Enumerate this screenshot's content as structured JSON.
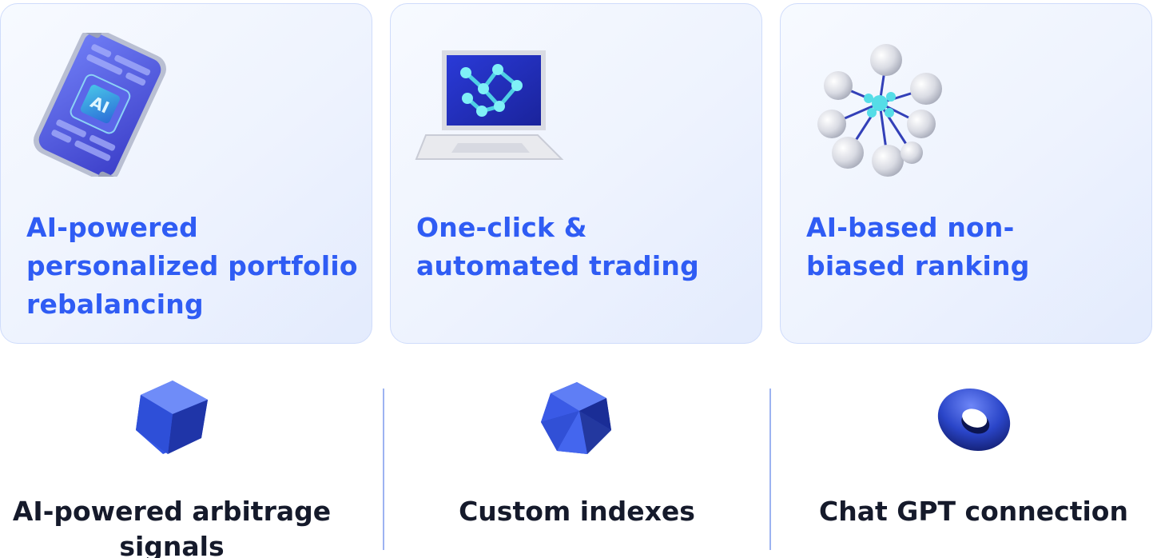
{
  "cards": [
    {
      "title": "AI-powered personalized portfolio rebalancing",
      "illustration": "ai-phone-chip-icon",
      "chip_text": "AI"
    },
    {
      "title": "One-click & automated trading",
      "illustration": "laptop-network-icon"
    },
    {
      "title": "AI-based non-biased ranking",
      "illustration": "sphere-network-icon"
    }
  ],
  "features": [
    {
      "label": "AI-powered arbitrage signals",
      "icon": "cube-icon"
    },
    {
      "label": "Custom indexes",
      "icon": "icosahedron-icon"
    },
    {
      "label": "Chat GPT connection",
      "icon": "torus-icon"
    }
  ],
  "colors": {
    "accent": "#2f5cf4",
    "card_border": "#cfdcfb",
    "card_bg": "#eef3fe",
    "divider": "#9db3f1",
    "text_dark": "#151a2b",
    "shape_blue": "#2a4fd6"
  }
}
